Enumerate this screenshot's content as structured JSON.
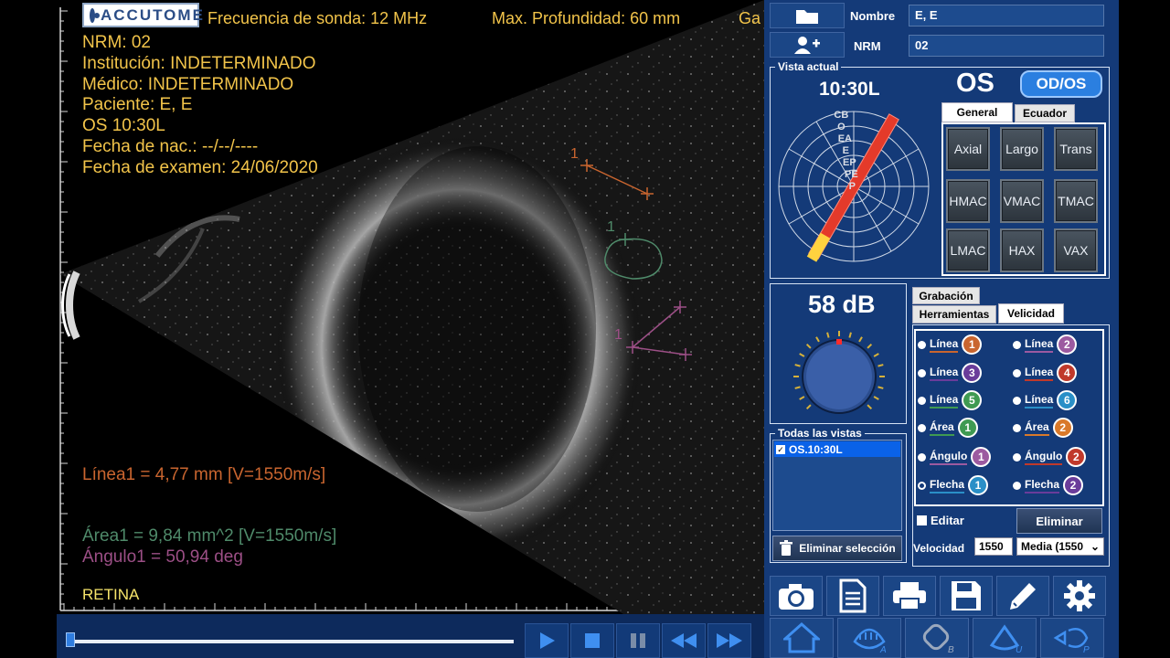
{
  "app": {
    "logo_text": "ACCUTOME"
  },
  "scan_header": {
    "frequency": "Frecuencia de sonda: 12 MHz",
    "depth": "Max. Profundidad: 60 mm",
    "gain_cut": "Ga"
  },
  "patient_overlay": [
    "NRM: 02",
    "Institución: INDETERMINADO",
    "Médico: INDETERMINADO",
    "Paciente: E, E",
    "OS  10:30L",
    "Fecha de nac.: --/--/----",
    "Fecha de examen: 24/06/2020"
  ],
  "measurements": {
    "line": {
      "text": "Línea1 = 4,77 mm    [V=1550m/s]",
      "color": "#c9652f"
    },
    "area": {
      "text": "Área1 = 9,84 mm^2 [V=1550m/s]",
      "color": "#4f8a6a"
    },
    "angle": {
      "text": "Ángulo1 = 50,94 deg",
      "color": "#9c4f86"
    },
    "marker_line": "1",
    "marker_area": "1",
    "marker_angle": "1"
  },
  "tissue_label": "RETINA",
  "transport": {
    "progress": 0.0
  },
  "patient": {
    "name_label": "Nombre",
    "name_value": "E, E",
    "id_label": "NRM",
    "id_value": "02"
  },
  "view": {
    "group_title": "Vista actual",
    "clock": "10:30L",
    "eye": "OS",
    "eye_toggle": "OD/OS",
    "labels": [
      "CB",
      "O",
      "EA",
      "E",
      "EP",
      "PE",
      "P"
    ],
    "tabs": [
      "General",
      "Ecuador"
    ],
    "probe_buttons": [
      "Axial",
      "Largo",
      "Trans",
      "HMAC",
      "VMAC",
      "TMAC",
      "LMAC",
      "HAX",
      "VAX"
    ]
  },
  "gain": {
    "value": "58 dB"
  },
  "all_views": {
    "title": "Todas las vistas",
    "items": [
      "OS.10:30L"
    ],
    "delete_label": "Eliminar selección"
  },
  "tools": {
    "tabs": [
      "Grabación",
      "Herramientas",
      "Velicidad"
    ],
    "items": [
      {
        "label": "Línea",
        "num": "1",
        "color": "#c9652f"
      },
      {
        "label": "Línea",
        "num": "2",
        "color": "#9c5aa0"
      },
      {
        "label": "Línea",
        "num": "3",
        "color": "#6a3c9a"
      },
      {
        "label": "Línea",
        "num": "4",
        "color": "#c0392b"
      },
      {
        "label": "Línea",
        "num": "5",
        "color": "#3f9a52"
      },
      {
        "label": "Línea",
        "num": "6",
        "color": "#2a8fc7"
      },
      {
        "label": "Área",
        "num": "1",
        "color": "#3f9a52"
      },
      {
        "label": "Área",
        "num": "2",
        "color": "#d9792a"
      },
      {
        "label": "Ángulo",
        "num": "1",
        "color": "#9c5aa0"
      },
      {
        "label": "Ángulo",
        "num": "2",
        "color": "#c0392b"
      },
      {
        "label": "Flecha",
        "num": "1",
        "color": "#2a8fc7"
      },
      {
        "label": "Flecha",
        "num": "2",
        "color": "#6a3c9a"
      }
    ],
    "edit_label": "Editar",
    "delete_label": "Eliminar",
    "velocity_label": "Velocidad",
    "velocity_value": "1550",
    "velocity_mode": "Media (1550"
  }
}
